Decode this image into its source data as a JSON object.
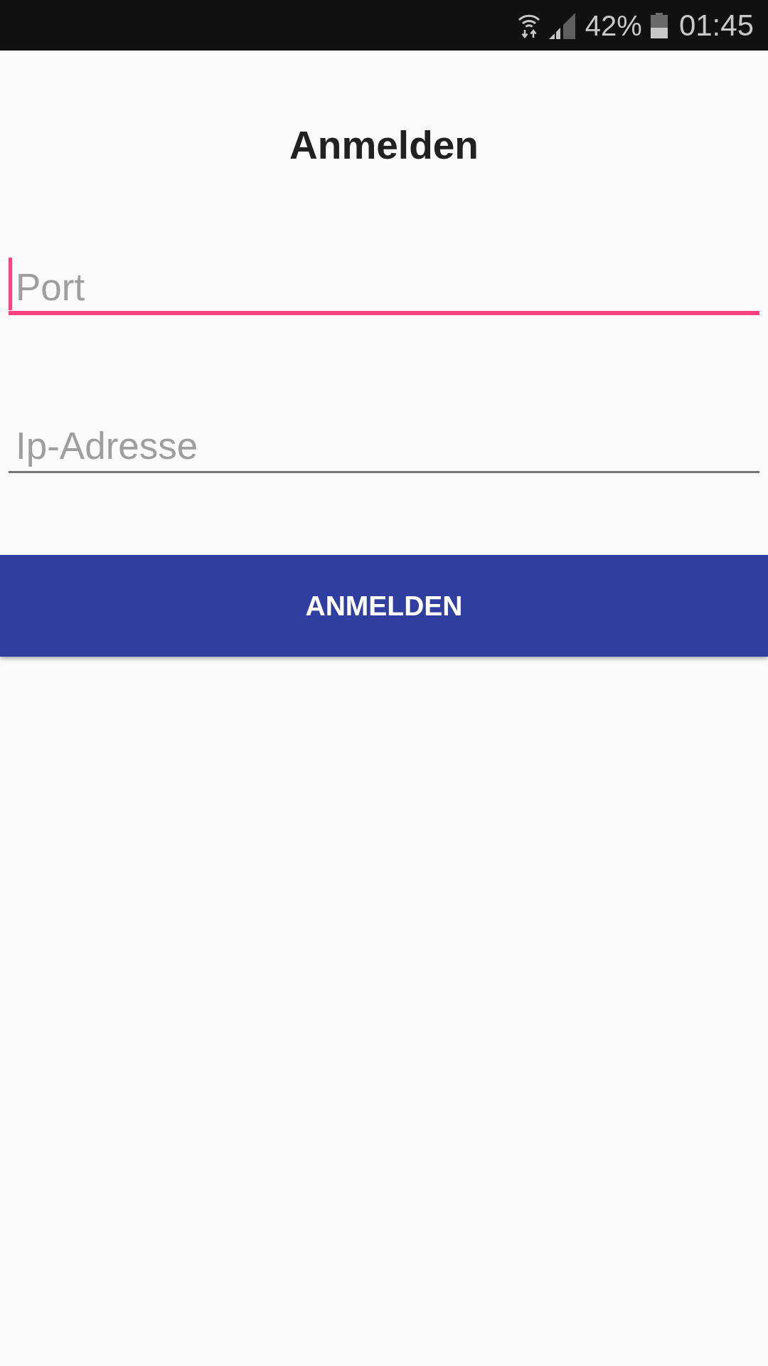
{
  "status_bar": {
    "battery": "42%",
    "time": "01:45"
  },
  "title": "Anmelden",
  "fields": [
    {
      "placeholder": "Port",
      "focused": true
    },
    {
      "placeholder": "Ip-Adresse",
      "focused": false
    }
  ],
  "button": {
    "label": "ANMELDEN"
  }
}
